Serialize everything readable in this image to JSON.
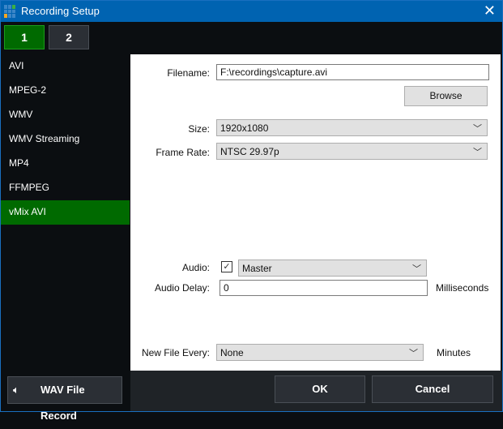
{
  "window": {
    "title": "Recording Setup",
    "close_icon": "close-icon"
  },
  "tabs": [
    {
      "label": "1",
      "active": true
    },
    {
      "label": "2",
      "active": false
    }
  ],
  "sidebar": {
    "items": [
      {
        "label": "AVI"
      },
      {
        "label": "MPEG-2"
      },
      {
        "label": "WMV"
      },
      {
        "label": "WMV Streaming"
      },
      {
        "label": "MP4"
      },
      {
        "label": "FFMPEG"
      },
      {
        "label": "vMix AVI",
        "selected": true
      }
    ],
    "wav_button": {
      "label": "WAV File Record",
      "icon": "speaker-icon"
    }
  },
  "form": {
    "filename_label": "Filename:",
    "filename_value": "F:\\recordings\\capture.avi",
    "browse_label": "Browse",
    "size_label": "Size:",
    "size_value": "1920x1080",
    "framerate_label": "Frame Rate:",
    "framerate_value": "NTSC 29.97p",
    "audio_label": "Audio:",
    "audio_checked": true,
    "audio_value": "Master",
    "audio_delay_label": "Audio Delay:",
    "audio_delay_value": "0",
    "audio_delay_unit": "Milliseconds",
    "newfile_label": "New File Every:",
    "newfile_value": "None",
    "newfile_unit": "Minutes"
  },
  "footer": {
    "ok_label": "OK",
    "cancel_label": "Cancel"
  },
  "colors": {
    "titlebar": "#0063b1",
    "selected": "#006a00"
  }
}
